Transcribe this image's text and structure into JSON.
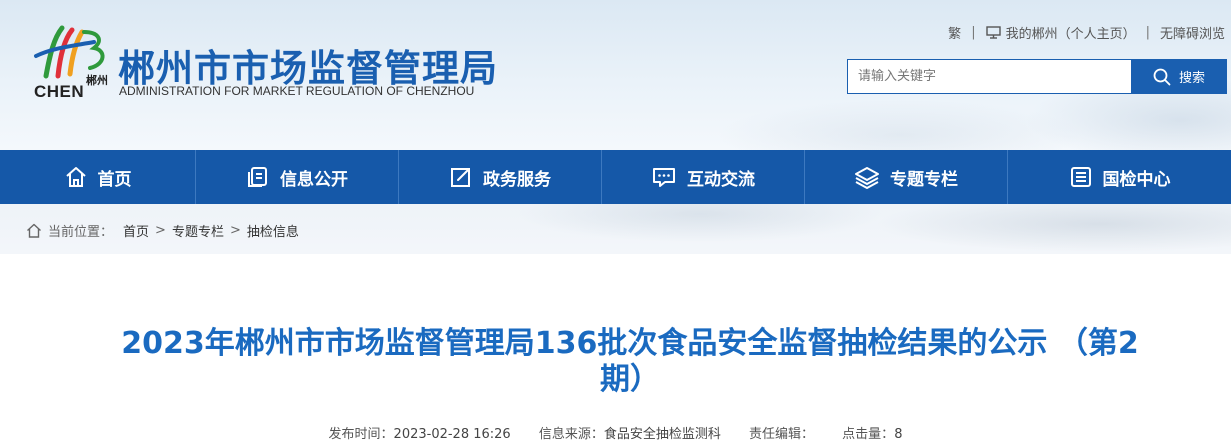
{
  "header": {
    "logo_small_text": "郴州",
    "logo_en": "CHEN",
    "site_title": "郴州市市场监督管理局",
    "site_subtitle": "ADMINISTRATION FOR MARKET REGULATION OF CHENZHOU"
  },
  "toplinks": {
    "traditional": "繁",
    "my_chenzhou": "我的郴州（个人主页）",
    "accessibility": "无障碍浏览"
  },
  "search": {
    "placeholder": "请输入关键字",
    "button_label": "搜索"
  },
  "nav": {
    "items": [
      {
        "label": "首页",
        "icon": "home-icon"
      },
      {
        "label": "信息公开",
        "icon": "document-icon"
      },
      {
        "label": "政务服务",
        "icon": "edit-icon"
      },
      {
        "label": "互动交流",
        "icon": "chat-icon"
      },
      {
        "label": "专题专栏",
        "icon": "layers-icon"
      },
      {
        "label": "国检中心",
        "icon": "list-icon"
      }
    ]
  },
  "breadcrumb": {
    "label": "当前位置：",
    "items": [
      "首页",
      "专题专栏",
      "抽检信息"
    ]
  },
  "article": {
    "title": "2023年郴州市市场监督管理局136批次食品安全监督抽检结果的公示 （第2期）",
    "meta": {
      "publish_time_label": "发布时间：",
      "publish_time": "2023-02-28 16:26",
      "source_label": "信息来源：",
      "source": "食品安全抽检监测科",
      "editor_label": "责任编辑：",
      "editor": "",
      "clicks_label": "点击量：",
      "clicks": "8"
    }
  },
  "colors": {
    "brand_blue": "#1a5fb0",
    "nav_blue": "#1558a8",
    "title_blue": "#1a6ac0"
  }
}
